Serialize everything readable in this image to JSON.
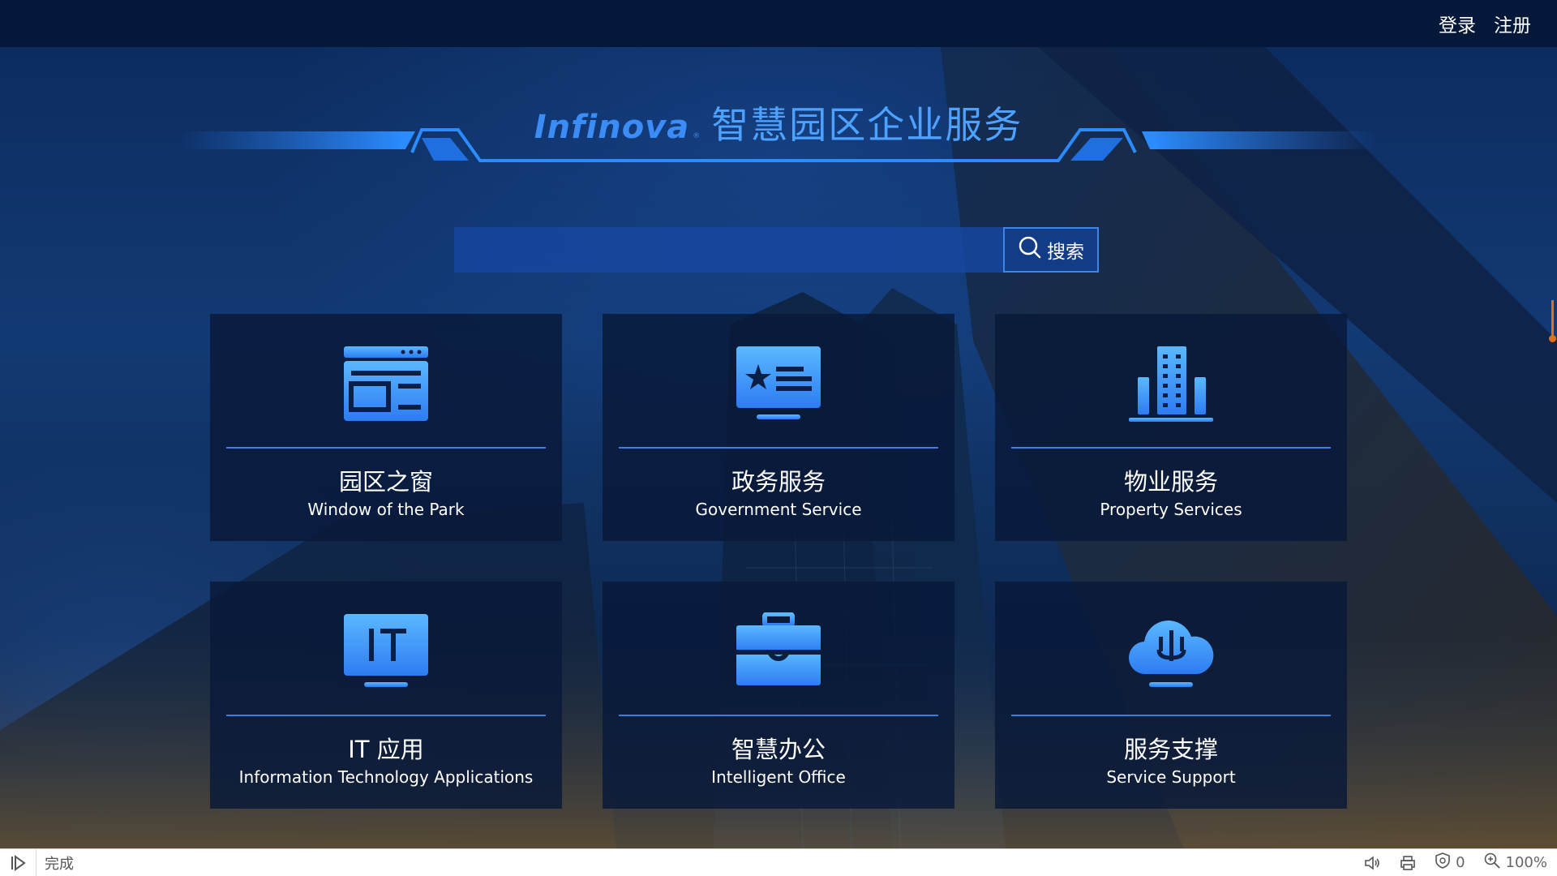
{
  "topbar": {
    "login": "登录",
    "register": "注册"
  },
  "header": {
    "logo": "Infinova",
    "logo_mark": "®",
    "title": "智慧园区企业服务"
  },
  "search": {
    "value": "",
    "placeholder": "",
    "button_label": "搜索",
    "icon": "search-icon"
  },
  "cards": [
    {
      "cn": "园区之窗",
      "en": "Window of the Park",
      "icon": "browser-window-icon"
    },
    {
      "cn": "政务服务",
      "en": "Government Service",
      "icon": "id-card-icon"
    },
    {
      "cn": "物业服务",
      "en": "Property Services",
      "icon": "building-icon"
    },
    {
      "cn": "IT 应用",
      "en": "Information Technology Applications",
      "icon": "it-monitor-icon"
    },
    {
      "cn": "智慧办公",
      "en": "Intelligent Office",
      "icon": "briefcase-icon"
    },
    {
      "cn": "服务支撑",
      "en": "Service Support",
      "icon": "cloud-plug-icon"
    }
  ],
  "statusbar": {
    "status": "完成",
    "blocked_count": "0",
    "zoom": "100%"
  },
  "colors": {
    "accent": "#3b8cf5",
    "icon_gradient_top": "#5bb8ff",
    "icon_gradient_bottom": "#2d7cf2",
    "card_bg": "#081838",
    "topbar_bg": "#05183a"
  }
}
